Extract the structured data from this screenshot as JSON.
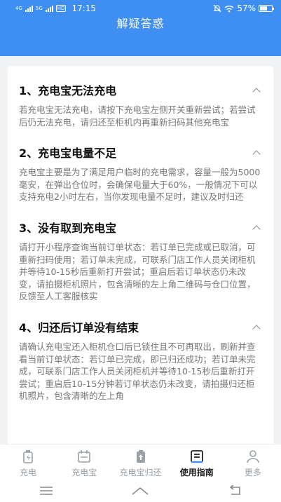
{
  "status": {
    "time": "17:15",
    "battery": "57%",
    "net1": "4G",
    "net2": "5G",
    "hd": "HD"
  },
  "header": {
    "title": "解疑答惑"
  },
  "faq": [
    {
      "title": "1、充电宝无法充电",
      "body": "若充电宝无法充电，请按下充电宝左侧开关重新尝试；若尝试后仍无法充电，请归还至柜机内再重新扫码其他充电宝"
    },
    {
      "title": "2、充电宝电量不足",
      "body": "充电宝主要是为了满足用户临时的充电需求，容量一般为5000毫安，在弹出仓位时，会确保电量大于60%，一般情况下可以支持充电2小时左右，当你发现电量不足时，建议及时归还"
    },
    {
      "title": "3、没有取到充电宝",
      "body": "请打开小程序查询当前订单状态：若订单已完成或已取消，可重新扫码使用；若订单未完成，可联系门店工作人员关闭柜机并等待10-15秒后重新打开尝试；重启后若订单状态仍未改变，请拍摄柜机照片，包含清晰的左上角二维码与仓口位置，反馈至人工客服核实"
    },
    {
      "title": "4、归还后订单没有结束",
      "body": "请确认充电宝还入柜机仓口后已锁住且不可再取出，刷新并查看当前订单状态：若订单已完成，即已归还成功；若订单未完成，可联系门店工作人员关闭柜机并等待10-15秒后重新打开尝试；重启后10-15分钟若订单状态仍未改变，请拍摄归还柜机照片，包含清晰的左上角"
    }
  ],
  "tabs": [
    {
      "label": "充电",
      "icon": "charge-icon"
    },
    {
      "label": "充电宝",
      "icon": "calendar-icon"
    },
    {
      "label": "充电宝归还",
      "icon": "return-icon"
    },
    {
      "label": "使用指南",
      "icon": "guide-icon"
    },
    {
      "label": "更多",
      "icon": "person-icon"
    }
  ],
  "colors": {
    "primary": "#3e8ff1",
    "text": "#111111",
    "muted": "#777777"
  }
}
